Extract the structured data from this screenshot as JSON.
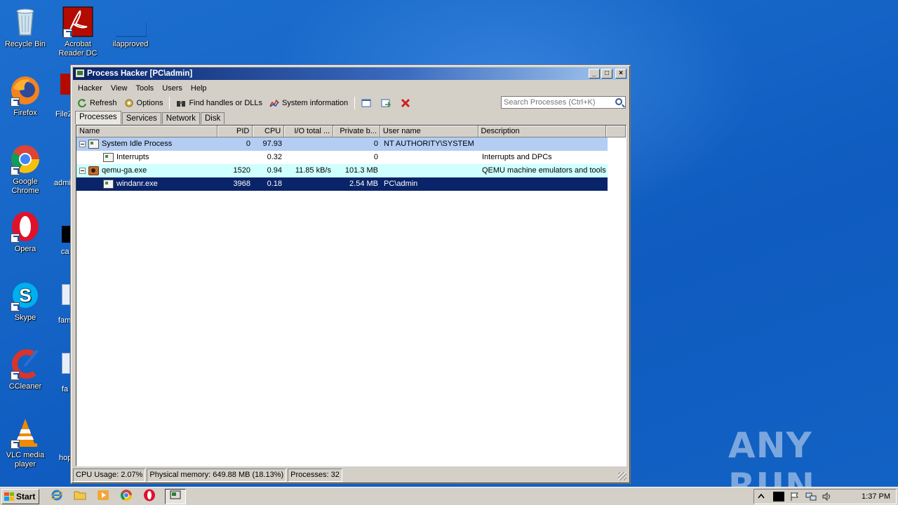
{
  "desktop": {
    "icons": [
      {
        "label": "Recycle Bin"
      },
      {
        "label": "Acrobat Reader DC"
      },
      {
        "label": "ilapproved"
      },
      {
        "label": "Firefox"
      },
      {
        "label": "FileZ"
      },
      {
        "label": "Google Chrome"
      },
      {
        "label": "admi"
      },
      {
        "label": "Opera"
      },
      {
        "label": "ca"
      },
      {
        "label": "Skype"
      },
      {
        "label": "fam"
      },
      {
        "label": "CCleaner"
      },
      {
        "label": "fa"
      },
      {
        "label": "VLC media player"
      },
      {
        "label": "hop"
      }
    ],
    "watermark": "ANY RUN"
  },
  "window": {
    "title": "Process Hacker [PC\\admin]",
    "menu": [
      "Hacker",
      "View",
      "Tools",
      "Users",
      "Help"
    ],
    "toolbar": {
      "refresh": "Refresh",
      "options": "Options",
      "find_handles": "Find handles or DLLs",
      "system_info": "System information"
    },
    "search_placeholder": "Search Processes (Ctrl+K)",
    "tabs": [
      "Processes",
      "Services",
      "Network",
      "Disk"
    ],
    "columns": [
      "Name",
      "PID",
      "CPU",
      "I/O total ...",
      "Private b...",
      "User name",
      "Description"
    ],
    "processes": [
      {
        "name": "System Idle Process",
        "pid": "0",
        "cpu": "97.93",
        "io": "",
        "private": "0",
        "user": "NT AUTHORITY\\SYSTEM",
        "desc": ""
      },
      {
        "name": "Interrupts",
        "pid": "",
        "cpu": "0.32",
        "io": "",
        "private": "0",
        "user": "",
        "desc": "Interrupts and DPCs"
      },
      {
        "name": "qemu-ga.exe",
        "pid": "1520",
        "cpu": "0.94",
        "io": "11.85 kB/s",
        "private": "101.3 MB",
        "user": "",
        "desc": "QEMU machine emulators and tools"
      },
      {
        "name": "windanr.exe",
        "pid": "3968",
        "cpu": "0.18",
        "io": "",
        "private": "2.54 MB",
        "user": "PC\\admin",
        "desc": ""
      }
    ],
    "status": {
      "cpu_usage": "CPU Usage: 2.07%",
      "physical_memory": "Physical memory: 649.88 MB (18.13%)",
      "processes": "Processes: 32"
    }
  },
  "taskbar": {
    "start": "Start",
    "clock": "1:37 PM"
  },
  "colors": {
    "title_active": "#0a246a",
    "row_system": "#b3cdf3",
    "row_qemu": "#cfffff",
    "row_selected": "#0a246a"
  }
}
